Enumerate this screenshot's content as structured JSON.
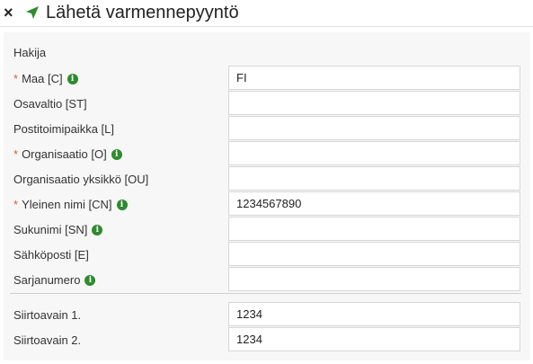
{
  "header": {
    "title": "Lähetä varmennepyyntö",
    "close_glyph": "×"
  },
  "section": {
    "title": "Hakija"
  },
  "fields": [
    {
      "label": "Maa [C]",
      "required": true,
      "info": true,
      "value": "FI"
    },
    {
      "label": "Osavaltio [ST]",
      "required": false,
      "info": false,
      "value": ""
    },
    {
      "label": "Postitoimipaikka [L]",
      "required": false,
      "info": false,
      "value": ""
    },
    {
      "label": "Organisaatio [O]",
      "required": true,
      "info": true,
      "value": ""
    },
    {
      "label": "Organisaatio yksikkö [OU]",
      "required": false,
      "info": false,
      "value": ""
    },
    {
      "label": "Yleinen nimi [CN]",
      "required": true,
      "info": true,
      "value": "1234567890"
    },
    {
      "label": "Sukunimi [SN]",
      "required": false,
      "info": true,
      "value": ""
    },
    {
      "label": "Sähköposti [E]",
      "required": false,
      "info": false,
      "value": ""
    },
    {
      "label": "Sarjanumero",
      "required": false,
      "info": true,
      "value": ""
    }
  ],
  "keys": [
    {
      "label": "Siirtoavain 1.",
      "value": "1234"
    },
    {
      "label": "Siirtoavain 2.",
      "value": "1234"
    }
  ],
  "colors": {
    "required_marker": "#e0602a",
    "info_icon": "#2e8b2e",
    "send_icon": "#2e8b2e"
  },
  "required_marker": "*",
  "info_glyph": "i"
}
